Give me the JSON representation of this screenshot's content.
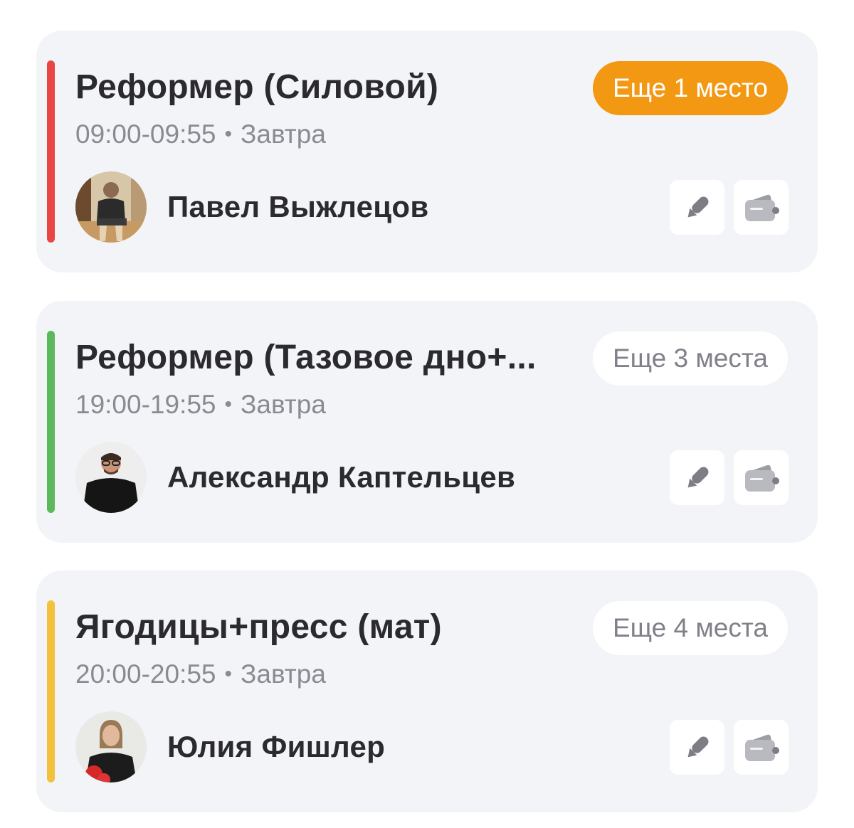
{
  "classes": [
    {
      "title": "Реформер (Силовой)",
      "time": "09:00-09:55",
      "day": "Завтра",
      "trainer": "Павел Выжлецов",
      "spots": "Еще 1 место",
      "accent_color": "#e84545",
      "badge_style": "primary",
      "avatar_icon": "trainer-avatar-photo",
      "actions": [
        "pencil-icon",
        "wallet-icon"
      ]
    },
    {
      "title": "Реформер (Тазовое дно+...",
      "time": "19:00-19:55",
      "day": "Завтра",
      "trainer": "Александр Каптельцев",
      "spots": "Еще 3 места",
      "accent_color": "#5cb85c",
      "badge_style": "secondary",
      "avatar_icon": "trainer-avatar-photo",
      "actions": [
        "pencil-icon",
        "wallet-icon"
      ]
    },
    {
      "title": "Ягодицы+пресс (мат)",
      "time": "20:00-20:55",
      "day": "Завтра",
      "trainer": "Юлия Фишлер",
      "spots": "Еще 4 места",
      "accent_color": "#f2c23c",
      "badge_style": "secondary",
      "avatar_icon": "trainer-avatar-photo",
      "actions": [
        "pencil-icon",
        "wallet-icon"
      ]
    }
  ],
  "colors": {
    "card_background": "#f3f4f8",
    "badge_primary": "#f29813",
    "icon_gray": "#7d7d86",
    "wallet_gray": "#b9b9c0"
  }
}
